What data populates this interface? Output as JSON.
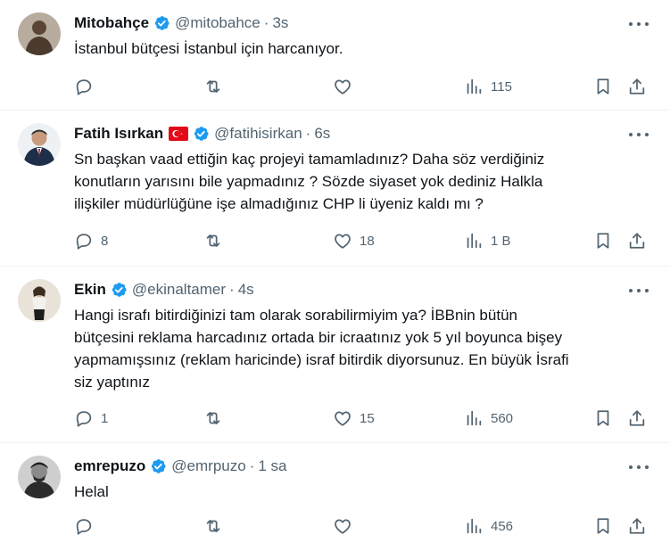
{
  "tweets": [
    {
      "name": "Mitobahçe",
      "handle": "@mitobahce",
      "sep": "·",
      "time": "3s",
      "text": "İstanbul bütçesi İstanbul için harcanıyor.",
      "replies": "",
      "retweets": "",
      "likes": "",
      "views": "115",
      "avatar_color": "#7a6450"
    },
    {
      "name": "Fatih Isırkan",
      "handle": "@fatihisirkan",
      "sep": "·",
      "time": "6s",
      "text": "Sn başkan vaad ettiğin kaç projeyi tamamladınız? Daha söz verdiğiniz\nkonutların yarısını bile yapmadınız ? Sözde siyaset yok dediniz Halkla\nilişkiler müdürlüğüne işe almadığınız CHP li üyeniz kaldı mı ?",
      "replies": "8",
      "retweets": "",
      "likes": "18",
      "views": "1 B",
      "avatar_color": "#2a3d5a"
    },
    {
      "name": "Ekin",
      "handle": "@ekinaltamer",
      "sep": "·",
      "time": "4s",
      "text": "Hangi israfı bitirdiğinizi tam olarak sorabilirmiyim ya? İBBnin bütün\nbütçesini reklama harcadınız ortada bir icraatınız yok 5 yıl boyunca bişey\nyapmamışsınız (reklam haricinde) israf bitirdik diyorsunuz. En büyük İsrafi\nsiz yaptınız",
      "replies": "1",
      "retweets": "",
      "likes": "15",
      "views": "560",
      "avatar_color": "#d8cfc4"
    },
    {
      "name": "emrepuzo",
      "handle": "@emrpuzo",
      "sep": "·",
      "time": "1 sa",
      "text": "Helal",
      "replies": "",
      "retweets": "",
      "likes": "",
      "views": "456",
      "avatar_color": "#3a3a3a"
    }
  ],
  "colors": {
    "verified": "#1d9bf0",
    "muted": "#536471",
    "text": "#0f1419",
    "divider": "#eff3f4",
    "flag_red": "#e30a17"
  },
  "icons": [
    "more-icon",
    "verified-badge-icon",
    "turkey-flag-icon",
    "reply-icon",
    "retweet-icon",
    "like-icon",
    "views-icon",
    "bookmark-icon",
    "share-icon"
  ]
}
